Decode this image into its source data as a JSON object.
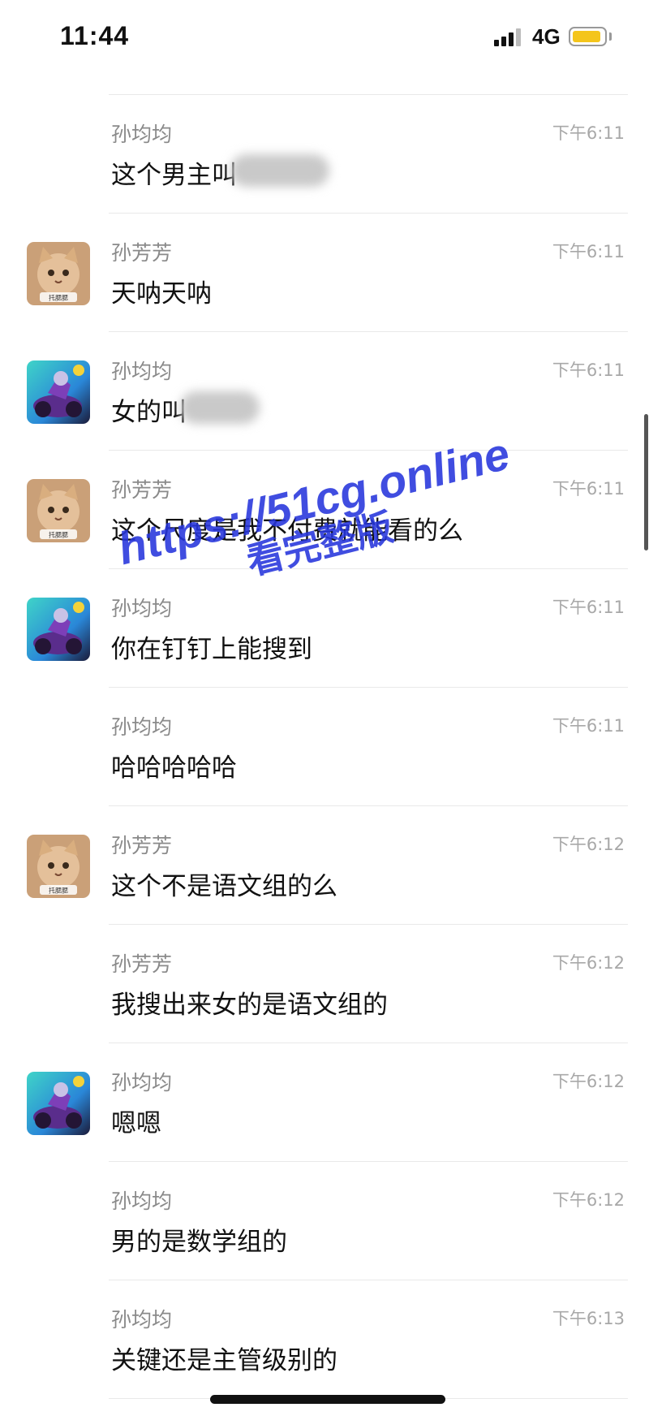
{
  "status_bar": {
    "time": "11:44",
    "network": "4G",
    "battery_color": "#f4c51b",
    "signal_icon": "cellular-signal-icon",
    "battery_icon": "battery-icon"
  },
  "messages": [
    {
      "sender": "孙均均",
      "time": "下午6:11",
      "text": "这个男主叫",
      "avatar": null,
      "redacted": true
    },
    {
      "sender": "孙芳芳",
      "time": "下午6:11",
      "text": "天呐天呐",
      "avatar": "cat-avatar"
    },
    {
      "sender": "孙均均",
      "time": "下午6:11",
      "text": "女的叫",
      "avatar": "anime-rider-avatar",
      "redacted": true
    },
    {
      "sender": "孙芳芳",
      "time": "下午6:11",
      "text": "这个尺度是我不付费就能看的么",
      "avatar": "cat-avatar"
    },
    {
      "sender": "孙均均",
      "time": "下午6:11",
      "text": "你在钉钉上能搜到",
      "avatar": "anime-rider-avatar"
    },
    {
      "sender": "孙均均",
      "time": "下午6:11",
      "text": "哈哈哈哈哈",
      "avatar": null
    },
    {
      "sender": "孙芳芳",
      "time": "下午6:12",
      "text": "这个不是语文组的么",
      "avatar": "cat-avatar"
    },
    {
      "sender": "孙芳芳",
      "time": "下午6:12",
      "text": "我搜出来女的是语文组的",
      "avatar": null
    },
    {
      "sender": "孙均均",
      "time": "下午6:12",
      "text": "嗯嗯",
      "avatar": "anime-rider-avatar"
    },
    {
      "sender": "孙均均",
      "time": "下午6:12",
      "text": "男的是数学组的",
      "avatar": null
    },
    {
      "sender": "孙均均",
      "time": "下午6:13",
      "text": "关键还是主管级别的",
      "avatar": null
    }
  ],
  "watermark": {
    "line1": "https://51cg.online",
    "line2": "看完整版",
    "color": "#2634dc"
  },
  "cat_avatar_caption": "托腮腮"
}
